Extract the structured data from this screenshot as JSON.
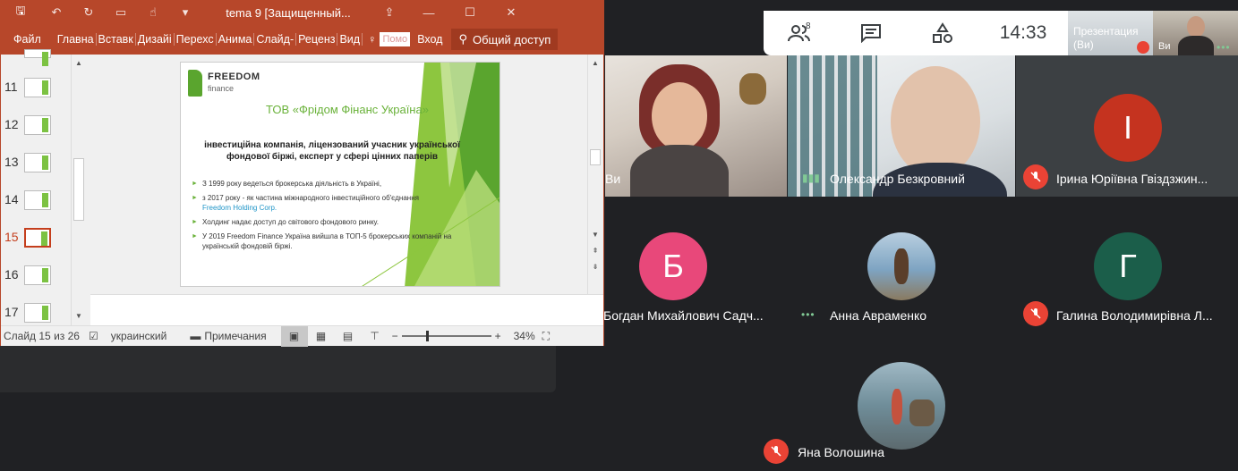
{
  "ppt": {
    "title": "tema 9 [Защищенный...",
    "ribbon": {
      "file": "Файл",
      "tabs": [
        "Главна",
        "Вставк",
        "Дизайі",
        "Перехс",
        "Анима",
        "Слайд-",
        "Реценз",
        "Вид"
      ],
      "search_placeholder": "Помо",
      "login": "Вход",
      "share": "Общий доступ"
    },
    "thumbnails": [
      "11",
      "12",
      "13",
      "14",
      "15",
      "16",
      "17"
    ],
    "selected_thumbnail": "15",
    "slide": {
      "logo_line1": "FREEDOM",
      "logo_line2": "finance",
      "title": "ТОВ «Фрідом Фінанс Україна»",
      "subtitle": "інвестиційна компанія, ліцензований учасник української фондової біржі, експерт у сфері цінних паперів",
      "bullets": [
        "З 1999 року ведеться брокерська діяльність в Україні,",
        "з 2017 року - як частина міжнародного інвестиційного об'єднання",
        "Холдинг надає доступ до світового фондового ринку.",
        "У 2019 Freedom Finance Україна вийшла в ТОП-5 брокерських компаній на українській фондовій біржі."
      ],
      "bullet2_link": "Freedom Holding Corp."
    },
    "status": {
      "slide_info": "Слайд 15 из 26",
      "language": "украинский",
      "notes": "Примечания",
      "zoom": "34%"
    }
  },
  "meet": {
    "participants_count": "8",
    "clock": "14:33",
    "self_tile_title": "Презентация",
    "self_tile_sub": "(Ви)",
    "self_tile_vi": "Ви",
    "tiles": [
      {
        "name": "Ви"
      },
      {
        "name": "Олександр Безкровний"
      },
      {
        "name": "Ірина Юріївна Гвіздзжин...",
        "initial": "І",
        "color": "#c5331f"
      },
      {
        "name": "Богдан Михайлович Садч...",
        "initial": "Б",
        "color": "#e8487a"
      },
      {
        "name": "Анна Авраменко"
      },
      {
        "name": "Галина Володимирівна Л...",
        "initial": "Г",
        "color": "#1b5e4a"
      },
      {
        "name": "Яна Волошина"
      }
    ]
  }
}
